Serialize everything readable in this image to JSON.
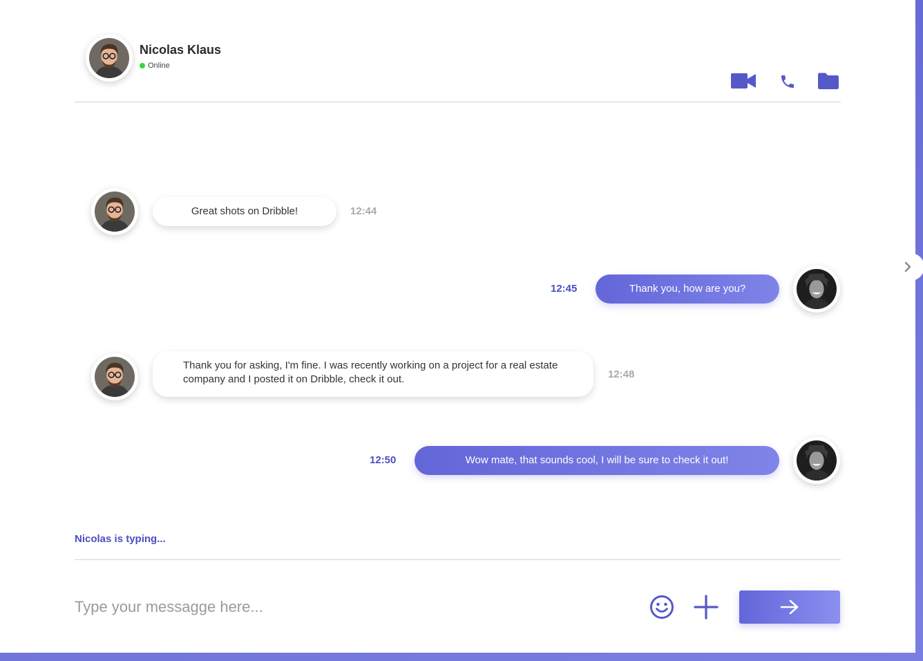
{
  "contact": {
    "name": "Nicolas Klaus",
    "status": "Online",
    "avatar_icon": "user-avatar-glasses"
  },
  "header_actions": [
    {
      "name": "video-call-icon"
    },
    {
      "name": "phone-call-icon"
    },
    {
      "name": "folder-icon"
    }
  ],
  "messages": [
    {
      "direction": "in",
      "text": "Great shots on Dribble!",
      "time": "12:44"
    },
    {
      "direction": "out",
      "text": "Thank you, how are you?",
      "time": "12:45"
    },
    {
      "direction": "in",
      "text": "Thank you for asking, I'm fine. I was recently working on a project for a real estate company and I posted it on Dribble, check it out.",
      "time": "12:48"
    },
    {
      "direction": "out",
      "text": "Wow mate, that sounds cool, I will be sure to check it out!",
      "time": "12:50"
    }
  ],
  "typing_indicator": "Nicolas is typing...",
  "composer": {
    "placeholder": "Type your messagge here...",
    "emoji_icon": "smiley-icon",
    "attach_icon": "plus-icon",
    "send_icon": "arrow-right-icon"
  },
  "colors": {
    "accent": "#6366d8",
    "accent_light": "#8a8ff0",
    "online": "#3fd13f",
    "time_in": "#a9a9a9",
    "time_out": "#4a4ec2"
  }
}
